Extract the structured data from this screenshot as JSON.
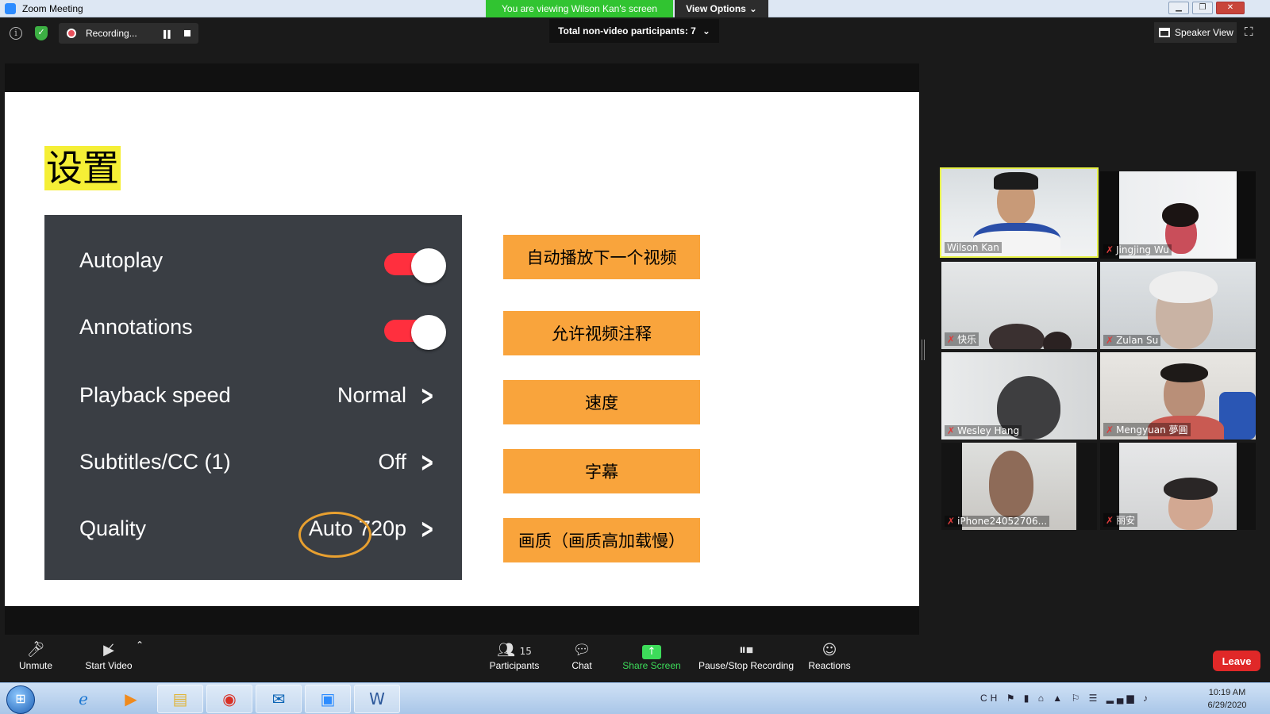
{
  "window": {
    "title": "Zoom Meeting",
    "viewing_banner": "You are viewing Wilson Kan's screen",
    "view_options_label": "View Options"
  },
  "topbar": {
    "recording_label": "Recording...",
    "participants_dropdown": "Total non-video participants: 7",
    "speaker_view_label": "Speaker View"
  },
  "slide": {
    "title": "设置",
    "settings": [
      {
        "label": "Autoplay",
        "type": "toggle",
        "value": "",
        "on": true
      },
      {
        "label": "Annotations",
        "type": "toggle",
        "value": "",
        "on": true
      },
      {
        "label": "Playback speed",
        "type": "link",
        "value": "Normal"
      },
      {
        "label": "Subtitles/CC (1)",
        "type": "link",
        "value": "Off"
      },
      {
        "label": "Quality",
        "type": "link",
        "value": "Auto 720p"
      }
    ],
    "notes": [
      "自动播放下一个视频",
      "允许视频注释",
      "速度",
      "字幕",
      "画质（画质高加载慢）"
    ],
    "colors": {
      "highlight": "#f5ef36",
      "note": "#f9a43c",
      "toggle_on": "#ff2f3e",
      "panel": "#3a3e44"
    }
  },
  "gallery": [
    {
      "name": "Wilson Kan",
      "muted": false,
      "active": true
    },
    {
      "name": "Jingjing Wu",
      "muted": true,
      "active": false
    },
    {
      "name": "快乐",
      "muted": true,
      "active": false
    },
    {
      "name": "Zulan Su",
      "muted": true,
      "active": false
    },
    {
      "name": "Wesley Hang",
      "muted": true,
      "active": false
    },
    {
      "name": "Mengyuan 夢圓",
      "muted": true,
      "active": false
    },
    {
      "name": "iPhone24052706...",
      "muted": true,
      "active": false
    },
    {
      "name": "丽安",
      "muted": true,
      "active": false
    }
  ],
  "toolbar": {
    "unmute": "Unmute",
    "start_video": "Start Video",
    "participants": "Participants",
    "participants_count": "15",
    "chat": "Chat",
    "share_screen": "Share Screen",
    "pause_stop_recording": "Pause/Stop Recording",
    "reactions": "Reactions",
    "leave": "Leave"
  },
  "taskbar": {
    "language": "CH",
    "time": "10:19 AM",
    "date": "6/29/2020"
  }
}
